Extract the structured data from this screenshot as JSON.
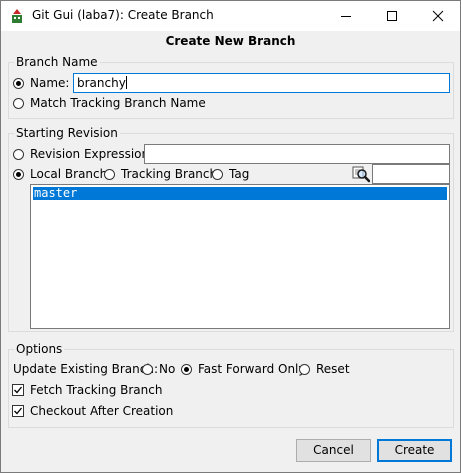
{
  "window": {
    "title": "Git Gui (laba7): Create Branch"
  },
  "dialog": {
    "title": "Create New Branch"
  },
  "branch_name": {
    "group_label": "Branch Name",
    "name_label": "Name:",
    "name_value": "branchy",
    "match_tracking_label": "Match Tracking Branch Name"
  },
  "starting_revision": {
    "group_label": "Starting Revision",
    "revision_expression_label": "Revision Expression:",
    "revision_expression_value": "",
    "local_branch_label": "Local Branch",
    "tracking_branch_label": "Tracking Branch",
    "tag_label": "Tag",
    "filter_value": "",
    "branches": [
      "master"
    ],
    "selected_branch": "master"
  },
  "options": {
    "group_label": "Options",
    "update_existing_label": "Update Existing Branch:",
    "no_label": "No",
    "fast_forward_label": "Fast Forward Only",
    "reset_label": "Reset",
    "fetch_tracking_label": "Fetch Tracking Branch",
    "fetch_tracking_checked": true,
    "checkout_after_label": "Checkout After Creation",
    "checkout_after_checked": true
  },
  "buttons": {
    "cancel": "Cancel",
    "create": "Create"
  },
  "colors": {
    "accent": "#0078d7",
    "window_bg": "#f0f0f0",
    "selection": "#0078d7"
  }
}
